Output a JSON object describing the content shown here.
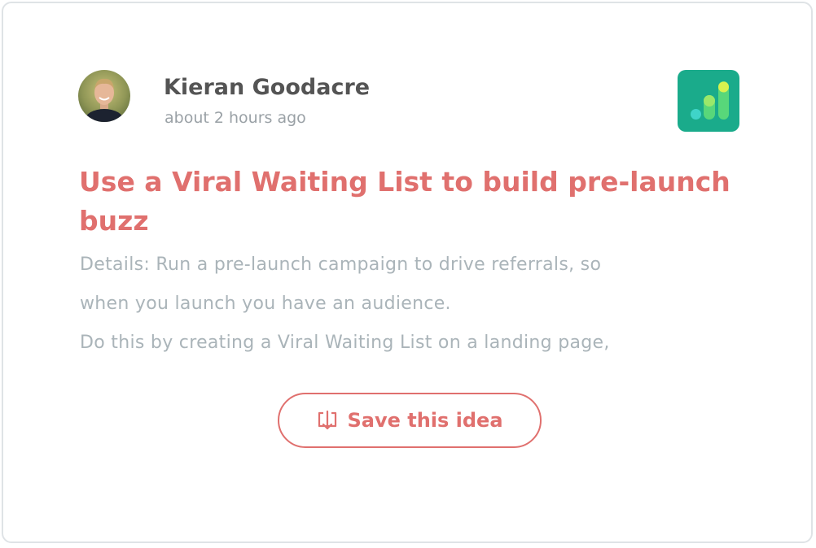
{
  "card": {
    "author": {
      "name": "Kieran Goodacre",
      "posted": "about 2 hours ago"
    },
    "app_logo_icon": "bar-chart-app-icon",
    "title": "Use a Viral Waiting List to build pre-launch buzz",
    "details_lines": [
      "Details: Run a pre-launch campaign to drive referrals, so",
      "when you launch you have an audience.",
      "Do this by creating a Viral Waiting List on a landing page,"
    ],
    "save_button": {
      "icon": "download-icon",
      "label": "Save this idea"
    }
  },
  "colors": {
    "accent": "#e0706e",
    "author_text": "#545454",
    "muted_text": "#9aa1a6",
    "details_text": "#aab4b9",
    "logo_bg": "#1aab8b",
    "card_border": "#dfe3e6"
  }
}
